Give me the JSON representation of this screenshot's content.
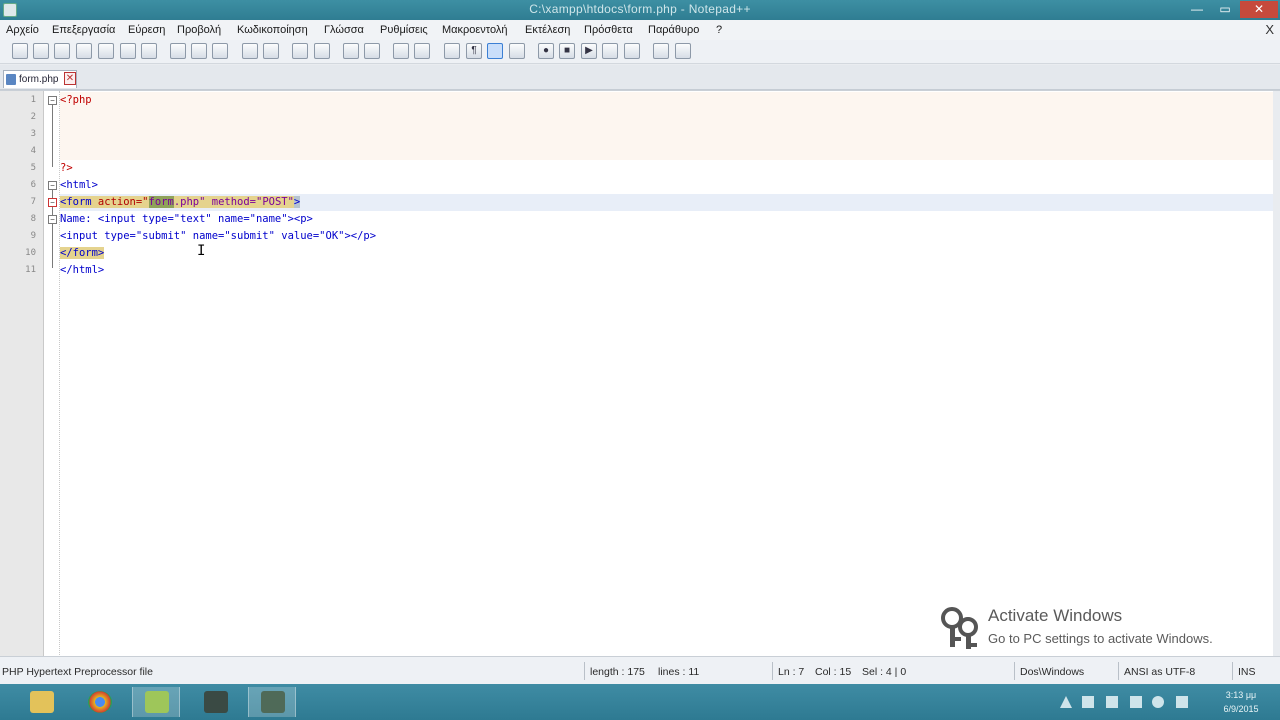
{
  "window": {
    "title": "C:\\xampp\\htdocs\\form.php - Notepad++",
    "min_label": "—",
    "max_label": "▭",
    "close_label": "✕"
  },
  "menu": {
    "items": [
      "Αρχείο",
      "Επεξεργασία",
      "Εύρεση",
      "Προβολή",
      "Κωδικοποίηση",
      "Γλώσσα",
      "Ρυθμίσεις",
      "Μακροεντολή",
      "Εκτέλεση",
      "Πρόσθετα",
      "Παράθυρο",
      "?"
    ],
    "close_doc": "X"
  },
  "toolbar": {
    "buttons": [
      "new-file-icon",
      "open-file-icon",
      "save-icon",
      "save-all-icon",
      "close-icon",
      "close-all-icon",
      "print-icon",
      "cut-icon",
      "copy-icon",
      "paste-icon",
      "undo-icon",
      "redo-icon",
      "find-icon",
      "replace-icon",
      "zoom-in-icon",
      "zoom-out-icon",
      "sync-vertical-icon",
      "sync-horizontal-icon",
      "word-wrap-icon",
      "show-all-chars-icon",
      "indent-guide-icon",
      "user-lang-icon",
      "record-macro-icon",
      "stop-record-icon",
      "play-macro-icon",
      "run-macro-multiple-icon",
      "save-macro-icon",
      "launch-browser-icon",
      "spell-check-icon"
    ]
  },
  "tabs": [
    {
      "label": "form.php",
      "close": "✕"
    }
  ],
  "editor": {
    "line_numbers": [
      "1",
      "2",
      "3",
      "4",
      "5",
      "6",
      "7",
      "8",
      "9",
      "10",
      "11"
    ],
    "lines": {
      "l1": "<?php",
      "l5": "?>",
      "l6_open": "<html>",
      "l7_a": "<form",
      "l7_b": " action=\"",
      "l7_c": "form",
      "l7_d": ".php\" method=\"POST\"",
      "l7_e": ">",
      "l8": "Name: <input type=\"text\" name=\"name\"><p>",
      "l9": "<input type=\"submit\" name=\"submit\" value=\"OK\"></p>",
      "l10": "</form>",
      "l11": "</html>"
    }
  },
  "watermark": {
    "title": "Activate Windows",
    "subtitle": "Go to PC settings to activate Windows."
  },
  "status": {
    "language": "PHP Hypertext Preprocessor file",
    "length": "length : 175",
    "lines": "lines : 11",
    "ln": "Ln : 7",
    "col": "Col : 15",
    "sel": "Sel : 4 | 0",
    "eol": "Dos\\Windows",
    "encoding": "ANSI as UTF-8",
    "mode": "INS"
  },
  "taskbar": {
    "apps": [
      "file-explorer-icon",
      "chrome-icon",
      "notepadpp-icon",
      "xampp-icon",
      "screen-recorder-icon"
    ],
    "clock_time": "3:13 μμ",
    "clock_date": "6/9/2015"
  },
  "colors": {
    "titlebar": "#2f7d92",
    "tag": "#0000cc",
    "attr": "#b00000",
    "value": "#7b0099"
  }
}
